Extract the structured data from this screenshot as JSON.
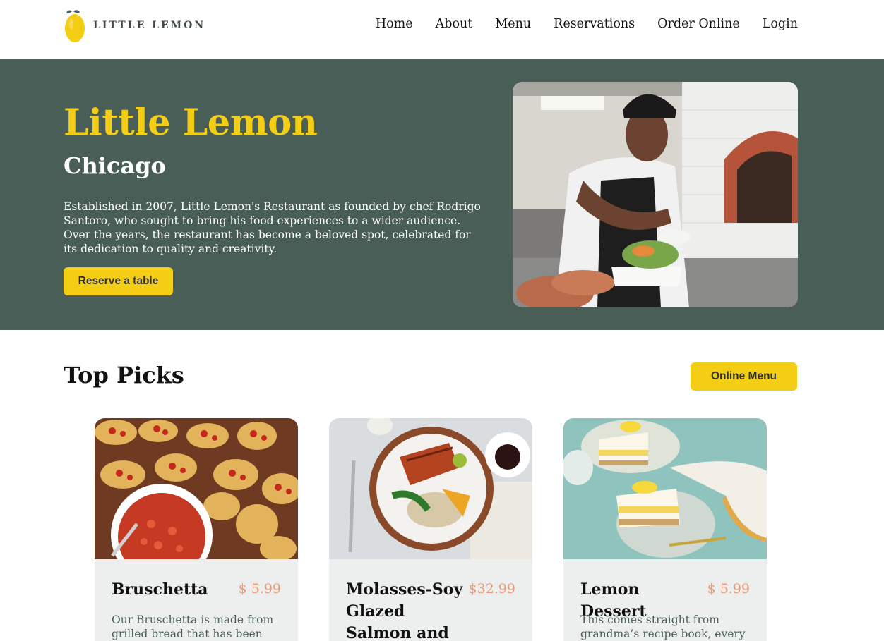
{
  "brand": {
    "name": "LITTLE LEMON",
    "logo_icon": "lemon-icon"
  },
  "nav": {
    "items": [
      {
        "label": "Home"
      },
      {
        "label": "About"
      },
      {
        "label": "Menu"
      },
      {
        "label": "Reservations"
      },
      {
        "label": "Order Online"
      },
      {
        "label": "Login"
      }
    ]
  },
  "hero": {
    "title": "Little Lemon",
    "subtitle": "Chicago",
    "description": "Established in 2007, Little Lemon's Restaurant as founded by chef Rodrigo Santoro, who sought to bring his food experiences to a wider audience. Over the years, the restaurant has become a beloved spot, celebrated for its dedication to quality and creativity.",
    "button_label": "Reserve a table"
  },
  "top_picks": {
    "title": "Top Picks",
    "button_label": "Online Menu",
    "cards": [
      {
        "name": "Bruschetta",
        "price": "$ 5.99",
        "description": "Our Bruschetta is made from grilled bread that has been"
      },
      {
        "name": "Molasses-Soy Glazed Salmon and Vegetables",
        "price": "$32.99",
        "description": ""
      },
      {
        "name": "Lemon Dessert",
        "price": "$ 5.99",
        "description": "This comes straight from grandma’s recipe book, every"
      }
    ]
  },
  "colors": {
    "primary_green": "#495e57",
    "primary_yellow": "#f4ce14",
    "price_salmon": "#ee9972",
    "card_bg": "#edefee"
  }
}
